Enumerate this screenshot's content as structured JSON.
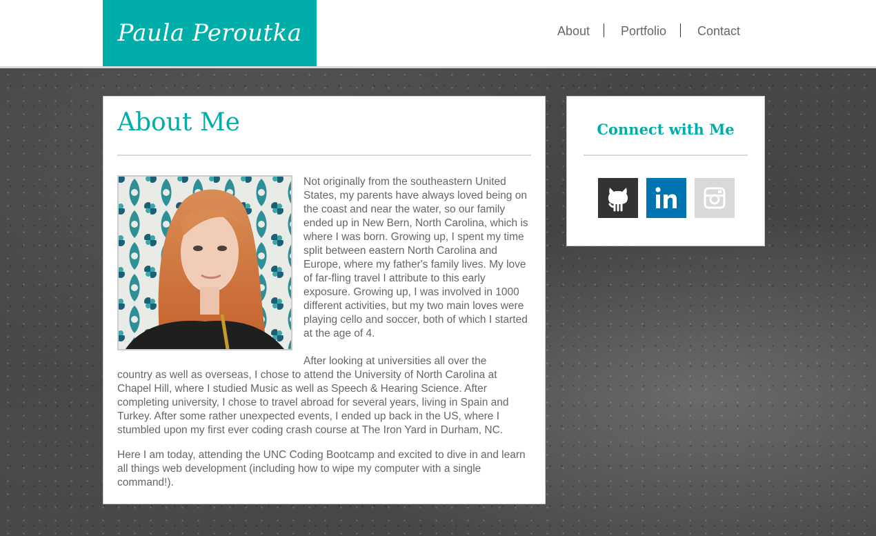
{
  "header": {
    "logo_text": "Paula Peroutka",
    "nav": [
      {
        "label": "About"
      },
      {
        "label": "Portfolio"
      },
      {
        "label": "Contact"
      }
    ]
  },
  "about": {
    "title": "About Me",
    "paragraph1": "Not originally from the southeastern United States, my parents have always loved being on the coast and near the water, so our family ended up in New Bern, North Carolina, which is where I was born. Growing up, I spent my time split between eastern North Carolina and Europe, where my father's family lives. My love of far-fling travel I attribute to this early exposure. Growing up, I was involved in 1000 different activities, but my two main loves were playing cello and soccer, both of which I started at the age of 4.",
    "paragraph2_col": "After looking at universities all over the",
    "paragraph2_rest": "country as well as overseas, I chose to attend the University of North Carolina at Chapel Hill, where I studied Music as well as Speech & Hearing Science. After completing university, I chose to travel abroad for several years, living in Spain and Turkey. After some rather unexpected events, I ended up back in the US, where I stumbled upon my first ever coding crash course at The Iron Yard in Durham, NC.",
    "paragraph3": "Here I am today, attending the UNC Coding Bootcamp and excited to dive in and learn all things web development (including how to wipe my computer with a single command!)."
  },
  "connect": {
    "title": "Connect with Me",
    "links": [
      {
        "icon": "github-icon",
        "color": "#333333"
      },
      {
        "icon": "linkedin-icon",
        "color": "#0073b1"
      },
      {
        "icon": "instagram-icon",
        "color": "#d9d9d9"
      }
    ]
  },
  "colors": {
    "accent": "#00aea9"
  }
}
